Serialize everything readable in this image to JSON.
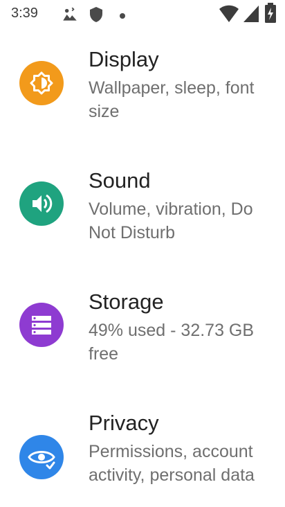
{
  "status_bar": {
    "time": "3:39"
  },
  "settings": {
    "items": [
      {
        "title": "Display",
        "subtitle": "Wallpaper, sleep, font size",
        "icon": "brightness-icon",
        "color": "#F29A1B"
      },
      {
        "title": "Sound",
        "subtitle": "Volume, vibration, Do Not Disturb",
        "icon": "volume-icon",
        "color": "#1FA37F"
      },
      {
        "title": "Storage",
        "subtitle": "49% used - 32.73 GB free",
        "icon": "storage-icon",
        "color": "#8E3BD1"
      },
      {
        "title": "Privacy",
        "subtitle": "Permissions, account activity, personal data",
        "icon": "eye-icon",
        "color": "#2F86E8"
      }
    ]
  }
}
